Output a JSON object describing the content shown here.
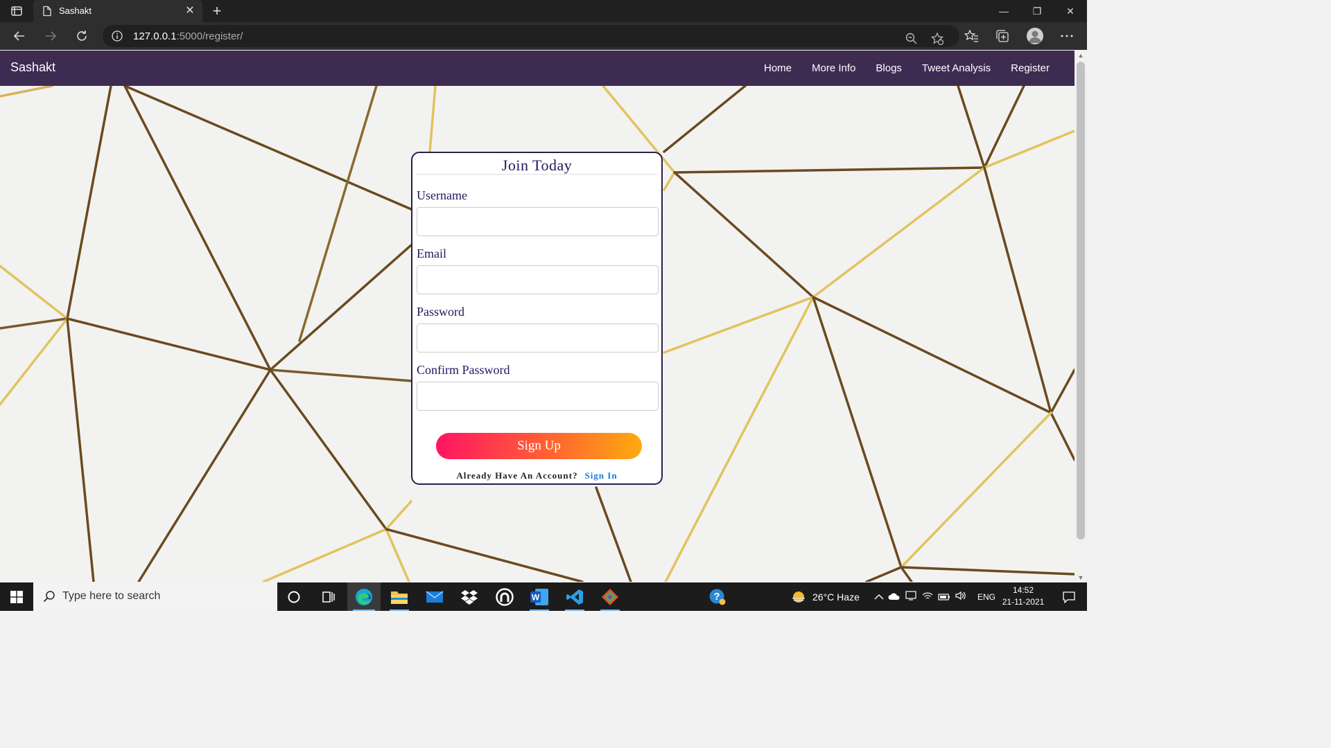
{
  "browser": {
    "tab_title": "Sashakt",
    "url_host": "127.0.0.1",
    "url_path": ":5000/register/",
    "window_controls": [
      "—",
      "❐",
      "✕"
    ]
  },
  "site": {
    "brand": "Sashakt",
    "nav": [
      "Home",
      "More Info",
      "Blogs",
      "Tweet Analysis",
      "Register"
    ]
  },
  "form": {
    "title": "Join Today",
    "fields": [
      {
        "label": "Username",
        "value": ""
      },
      {
        "label": "Email",
        "value": ""
      },
      {
        "label": "Password",
        "value": ""
      },
      {
        "label": "Confirm Password",
        "value": ""
      }
    ],
    "submit_label": "Sign Up",
    "already_text": "Already Have An Account?",
    "signin_link": "Sign In",
    "gradient_colors": [
      "#ff1463",
      "#ff6a2e",
      "#ffab10"
    ]
  },
  "taskbar": {
    "search_placeholder": "Type here to search",
    "weather": "26°C  Haze",
    "language": "ENG",
    "time": "14:52",
    "date": "21-11-2021"
  },
  "colors": {
    "navbar": "#3e2b52",
    "title_text": "#1d1a5e",
    "link": "#1e7ad8"
  }
}
